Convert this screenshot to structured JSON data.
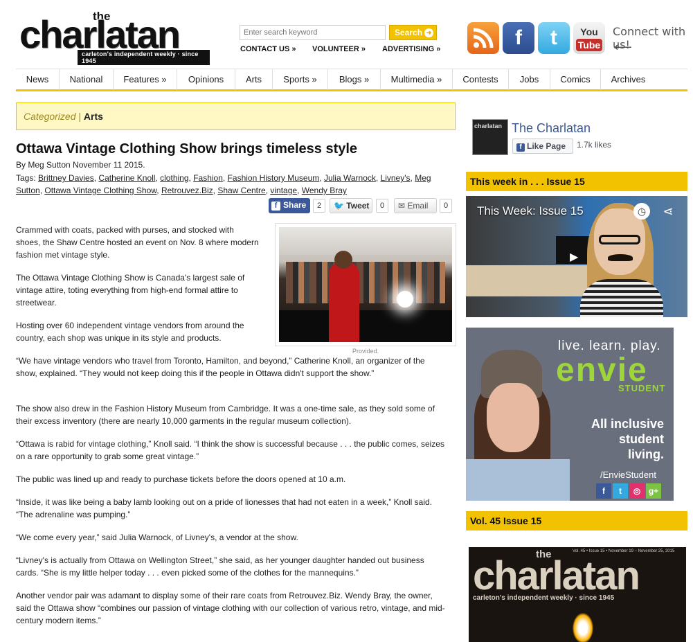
{
  "header": {
    "logo_the": "the",
    "logo_word": "charlatan",
    "logo_tagline": "carleton's independent weekly · since 1945",
    "search_placeholder": "Enter search keyword",
    "search_button": "Search",
    "links": [
      "CONTACT US »",
      "VOLUNTEER »",
      "ADVERTISING »"
    ],
    "connect": "Connect with us!",
    "social_icons": [
      "rss-icon",
      "facebook-icon",
      "twitter-icon",
      "youtube-icon"
    ],
    "youtube_text": "You",
    "youtube_tube": "Tube"
  },
  "nav": [
    {
      "label": "News"
    },
    {
      "label": "National"
    },
    {
      "label": "Features »"
    },
    {
      "label": "Opinions"
    },
    {
      "label": "Arts"
    },
    {
      "label": "Sports »"
    },
    {
      "label": "Blogs »"
    },
    {
      "label": "Multimedia »"
    },
    {
      "label": "Contests"
    },
    {
      "label": "Jobs"
    },
    {
      "label": "Comics"
    },
    {
      "label": "Archives"
    }
  ],
  "category": {
    "label": "Categorized",
    "sep": "|",
    "value": "Arts"
  },
  "article": {
    "title": "Ottawa Vintage Clothing Show brings timeless style",
    "byline": "By Meg Sutton  November 11 2015.",
    "tags_label": "Tags:",
    "tags": [
      "Brittney Davies",
      "Catherine Knoll",
      "clothing",
      "Fashion",
      "Fashion History Museum",
      "Julia Warnock",
      "Livney's",
      "Meg Sutton",
      "Ottawa Vintage Clothing Show",
      "Retrouvez.Biz",
      "Shaw Centre",
      "vintage",
      "Wendy Bray"
    ],
    "share": {
      "facebook": "Share",
      "facebook_count": "2",
      "tweet": "Tweet",
      "tweet_count": "0",
      "email": "Email",
      "email_count": "0"
    },
    "photo_caption": "Provided.",
    "paragraphs": [
      "Crammed with coats, packed with purses, and stocked with shoes, the Shaw Centre hosted an event on Nov. 8 where modern fashion met vintage style.",
      "The Ottawa Vintage Clothing Show is Canada's largest sale of vintage attire, toting everything from high-end formal attire to streetwear.",
      "Hosting over 60 independent vintage vendors from around the country, each shop was unique in its style and products.",
      "“We have vintage vendors who travel from Toronto, Hamilton, and beyond,” Catherine Knoll, an organizer of the show, explained. “They would not keep doing this if the people in Ottawa didn't support the show.”",
      "The show also drew in the Fashion History Museum from Cambridge. It was a one-time sale, as they sold some of their excess inventory (there are nearly 10,000 garments in the regular museum collection).",
      "“Ottawa is rabid for vintage clothing,” Knoll said. “I think the show is successful because . . . the public comes, seizes on a rare opportunity to grab some great vintage.”",
      "The public was lined up and ready to purchase tickets before the doors opened at 10 a.m.",
      "“Inside, it was like being a baby lamb looking out on a pride of lionesses that had not eaten in a week,” Knoll said. “The adrenaline was pumping.”",
      "“We come every year,” said Julia Warnock, of Livney's, a vendor at the show.",
      "“Livney's is actually from Ottawa on Wellington Street,” she said, as her younger daughter handed out business cards. “She is my little helper today . . . even picked some of the clothes for the mannequins.”",
      "Another vendor pair was adamant to display some of their rare coats from Retrouvez.Biz. Wendy Bray, the owner, said the Ottawa show “combines our passion of vintage clothing with our collection of various retro, vintage, and mid-century modern items.”"
    ]
  },
  "sidebar": {
    "fb_name": "The Charlatan",
    "fb_like": "Like Page",
    "fb_count": "1.7k likes",
    "week_heading": "This week in . . . Issue 15",
    "video_title": "This Week: Issue 15",
    "ad": {
      "line1": "live. learn. play.",
      "brand": "envie",
      "sub": "STUDENT",
      "inclusive": "All inclusive student living.",
      "handle": "/EnvieStudent"
    },
    "issue_heading": "Vol. 45 Issue 15",
    "cover_top": "Vol. 45 • Issue 15 • November 19 – November 25, 2015",
    "cover_the": "the",
    "cover_word": "charlatan",
    "cover_tag": "carleton's independent weekly · since 1945"
  },
  "colors": {
    "accent": "#f2c100",
    "facebook": "#3b5998",
    "envie_green": "#9ed63a"
  }
}
